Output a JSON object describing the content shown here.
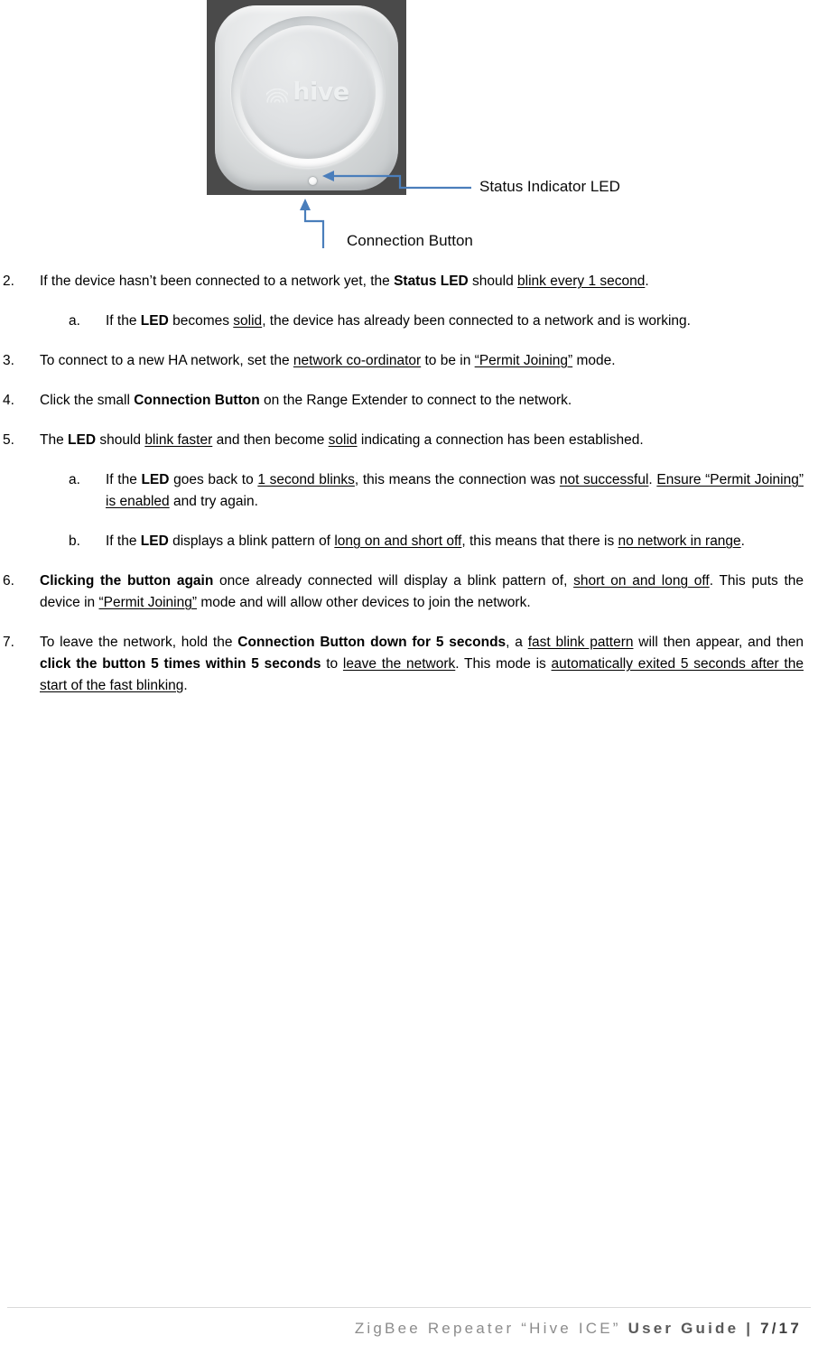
{
  "figure": {
    "device_logo_text": "hive",
    "callouts": [
      {
        "name": "status-indicator-led",
        "label": "Status Indicator LED"
      },
      {
        "name": "connection-button",
        "label": "Connection Button"
      }
    ]
  },
  "content": {
    "items": [
      {
        "marker": "2.",
        "level": 1,
        "segments": [
          {
            "text": "If the device hasn’t been connected to a network yet, the ",
            "style": "normal"
          },
          {
            "text": "Status LED",
            "style": "bold"
          },
          {
            "text": " should ",
            "style": "normal"
          },
          {
            "text": "blink every 1 second",
            "style": "underline"
          },
          {
            "text": ".",
            "style": "normal"
          }
        ]
      },
      {
        "marker": "a.",
        "level": 2,
        "segments": [
          {
            "text": "If the ",
            "style": "normal"
          },
          {
            "text": "LED",
            "style": "bold"
          },
          {
            "text": " becomes ",
            "style": "normal"
          },
          {
            "text": "solid",
            "style": "underline"
          },
          {
            "text": ", the device has already been connected to a network and is working.",
            "style": "normal"
          }
        ]
      },
      {
        "marker": "3.",
        "level": 1,
        "segments": [
          {
            "text": "To connect to a new HA network, set the ",
            "style": "normal"
          },
          {
            "text": "network co-ordinator",
            "style": "underline"
          },
          {
            "text": " to be in ",
            "style": "normal"
          },
          {
            "text": "“Permit Joining”",
            "style": "underline"
          },
          {
            "text": " mode.",
            "style": "normal"
          }
        ]
      },
      {
        "marker": "4.",
        "level": 1,
        "segments": [
          {
            "text": "Click the small ",
            "style": "normal"
          },
          {
            "text": "Connection Button",
            "style": "bold"
          },
          {
            "text": " on the Range Extender to connect to the network.",
            "style": "normal"
          }
        ]
      },
      {
        "marker": "5.",
        "level": 1,
        "segments": [
          {
            "text": "The ",
            "style": "normal"
          },
          {
            "text": "LED",
            "style": "bold"
          },
          {
            "text": " should ",
            "style": "normal"
          },
          {
            "text": "blink faster",
            "style": "underline"
          },
          {
            "text": " and then become ",
            "style": "normal"
          },
          {
            "text": "solid",
            "style": "underline"
          },
          {
            "text": " indicating a connection has been established.",
            "style": "normal"
          }
        ]
      },
      {
        "marker": "a.",
        "level": 2,
        "segments": [
          {
            "text": "If the ",
            "style": "normal"
          },
          {
            "text": "LED",
            "style": "bold"
          },
          {
            "text": " goes back to ",
            "style": "normal"
          },
          {
            "text": "1 second blinks",
            "style": "underline"
          },
          {
            "text": ", this means the connection was ",
            "style": "normal"
          },
          {
            "text": "not successful",
            "style": "underline"
          },
          {
            "text": ". ",
            "style": "normal"
          },
          {
            "text": "Ensure “Permit Joining” is enabled",
            "style": "underline"
          },
          {
            "text": " and try again.",
            "style": "normal"
          }
        ]
      },
      {
        "marker": "b.",
        "level": 2,
        "segments": [
          {
            "text": "If the ",
            "style": "normal"
          },
          {
            "text": "LED",
            "style": "bold"
          },
          {
            "text": " displays a blink pattern of ",
            "style": "normal"
          },
          {
            "text": "long on and short off",
            "style": "underline"
          },
          {
            "text": ", this means that there is ",
            "style": "normal"
          },
          {
            "text": "no network in range",
            "style": "underline"
          },
          {
            "text": ".",
            "style": "normal"
          }
        ]
      },
      {
        "marker": "6.",
        "level": 1,
        "segments": [
          {
            "text": "Clicking the button again",
            "style": "bold"
          },
          {
            "text": " once already connected will display a blink pattern of, ",
            "style": "normal"
          },
          {
            "text": "short on and long off",
            "style": "underline"
          },
          {
            "text": ". This puts the device in ",
            "style": "normal"
          },
          {
            "text": "“Permit Joining”",
            "style": "underline"
          },
          {
            "text": " mode and will allow other devices to join the network.",
            "style": "normal"
          }
        ]
      },
      {
        "marker": "7.",
        "level": 1,
        "segments": [
          {
            "text": "To leave the network, hold the ",
            "style": "normal"
          },
          {
            "text": "Connection Button down for 5 seconds",
            "style": "bold"
          },
          {
            "text": ", a ",
            "style": "normal"
          },
          {
            "text": "fast blink pattern",
            "style": "underline"
          },
          {
            "text": " will then appear, and then ",
            "style": "normal"
          },
          {
            "text": "click the button 5 times within 5 seconds",
            "style": "bold"
          },
          {
            "text": " to ",
            "style": "normal"
          },
          {
            "text": "leave the network",
            "style": "underline"
          },
          {
            "text": ". This mode is ",
            "style": "normal"
          },
          {
            "text": "automatically exited 5 seconds after the start of the fast blinking",
            "style": "underline"
          },
          {
            "text": ".",
            "style": "normal"
          }
        ]
      }
    ]
  },
  "footer": {
    "document_title": "ZigBee Repeater “Hive ICE” ",
    "document_type": "User Guide",
    "separator": " | ",
    "page_number": "7/17"
  },
  "colors": {
    "callout_line": "#4a7ebb",
    "text": "#000000",
    "footer_light": "#8c8c8c",
    "footer_strong": "#5a5a5a"
  }
}
